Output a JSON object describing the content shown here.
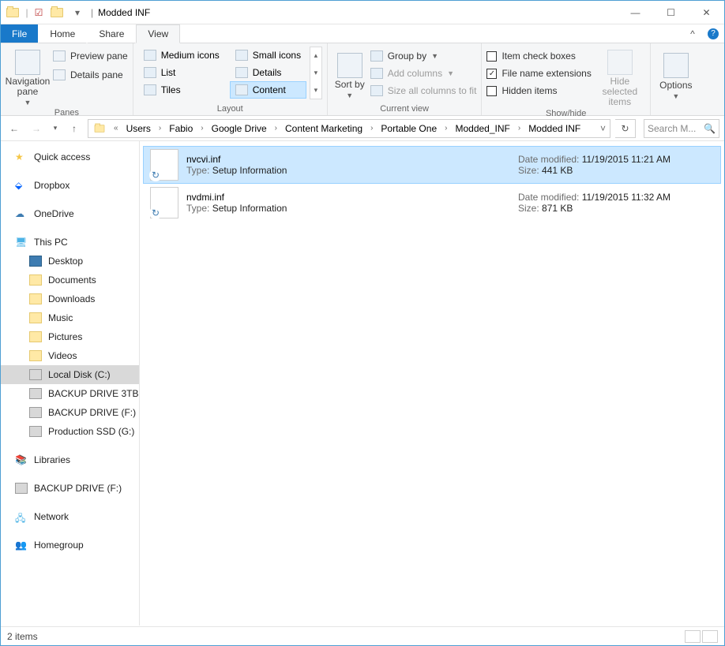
{
  "window": {
    "title": "Modded INF",
    "sep": "|"
  },
  "tabs": {
    "file": "File",
    "home": "Home",
    "share": "Share",
    "view": "View"
  },
  "ribbon": {
    "panes": {
      "nav": "Navigation pane",
      "preview": "Preview pane",
      "details": "Details pane",
      "label": "Panes"
    },
    "layout": {
      "medium": "Medium icons",
      "small": "Small icons",
      "list": "List",
      "details": "Details",
      "tiles": "Tiles",
      "content": "Content",
      "label": "Layout"
    },
    "currentview": {
      "sortby": "Sort by",
      "groupby": "Group by",
      "addcols": "Add columns",
      "sizecols": "Size all columns to fit",
      "label": "Current view"
    },
    "showhide": {
      "checkboxes": "Item check boxes",
      "ext": "File name extensions",
      "hidden": "Hidden items",
      "hidesel": "Hide selected items",
      "label": "Show/hide"
    },
    "options": "Options"
  },
  "breadcrumb": {
    "prefix": "«",
    "items": [
      "Users",
      "Fabio",
      "Google Drive",
      "Content Marketing",
      "Portable One",
      "Modded_INF",
      "Modded INF"
    ]
  },
  "search": {
    "placeholder": "Search M..."
  },
  "tree": {
    "quick": "Quick access",
    "dropbox": "Dropbox",
    "onedrive": "OneDrive",
    "thispc": "This PC",
    "desktop": "Desktop",
    "documents": "Documents",
    "downloads": "Downloads",
    "music": "Music",
    "pictures": "Pictures",
    "videos": "Videos",
    "localdisk": "Local Disk (C:)",
    "backup3": "BACKUP DRIVE 3TB",
    "backupf": "BACKUP DRIVE (F:)",
    "prodssd": "Production SSD (G:)",
    "libraries": "Libraries",
    "backupf2": "BACKUP DRIVE (F:)",
    "network": "Network",
    "homegroup": "Homegroup"
  },
  "files": [
    {
      "name": "nvcvi.inf",
      "type_lbl": "Type:",
      "type_val": "Setup Information",
      "mod_lbl": "Date modified:",
      "mod_val": "11/19/2015 11:21 AM",
      "size_lbl": "Size:",
      "size_val": "441 KB"
    },
    {
      "name": "nvdmi.inf",
      "type_lbl": "Type:",
      "type_val": "Setup Information",
      "mod_lbl": "Date modified:",
      "mod_val": "11/19/2015 11:32 AM",
      "size_lbl": "Size:",
      "size_val": "871 KB"
    }
  ],
  "status": {
    "count": "2 items"
  }
}
